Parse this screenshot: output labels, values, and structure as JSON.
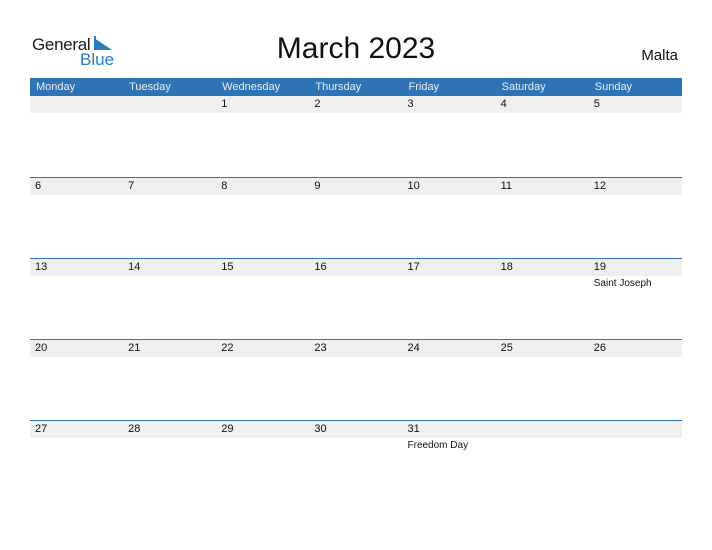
{
  "logo": {
    "general": "General",
    "blue": "Blue"
  },
  "title": "March 2023",
  "country": "Malta",
  "weekdays": [
    "Monday",
    "Tuesday",
    "Wednesday",
    "Thursday",
    "Friday",
    "Saturday",
    "Sunday"
  ],
  "weeks": [
    [
      {
        "day": ""
      },
      {
        "day": ""
      },
      {
        "day": "1"
      },
      {
        "day": "2"
      },
      {
        "day": "3"
      },
      {
        "day": "4"
      },
      {
        "day": "5"
      }
    ],
    [
      {
        "day": "6"
      },
      {
        "day": "7"
      },
      {
        "day": "8"
      },
      {
        "day": "9"
      },
      {
        "day": "10"
      },
      {
        "day": "11"
      },
      {
        "day": "12"
      }
    ],
    [
      {
        "day": "13"
      },
      {
        "day": "14"
      },
      {
        "day": "15"
      },
      {
        "day": "16"
      },
      {
        "day": "17"
      },
      {
        "day": "18"
      },
      {
        "day": "19",
        "holiday": "Saint Joseph"
      }
    ],
    [
      {
        "day": "20"
      },
      {
        "day": "21"
      },
      {
        "day": "22"
      },
      {
        "day": "23"
      },
      {
        "day": "24"
      },
      {
        "day": "25"
      },
      {
        "day": "26"
      }
    ],
    [
      {
        "day": "27"
      },
      {
        "day": "28"
      },
      {
        "day": "29"
      },
      {
        "day": "30"
      },
      {
        "day": "31",
        "holiday": "Freedom Day"
      },
      {
        "day": ""
      },
      {
        "day": ""
      }
    ]
  ],
  "colors": {
    "header": "#2e73b5",
    "brand_blue": "#2a7bc4",
    "band": "#efefef"
  }
}
